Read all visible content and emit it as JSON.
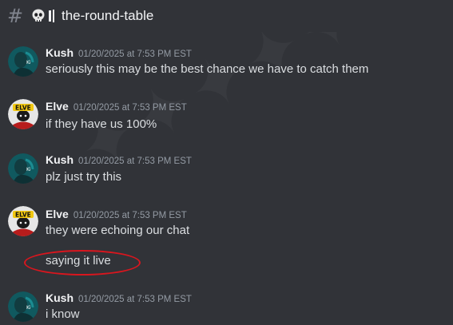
{
  "channel": {
    "name": "the-round-table",
    "icon": "skull-icon"
  },
  "messages": [
    {
      "author": "Kush",
      "timestamp": "01/20/2025 at 7:53 PM EST",
      "text": "seriously this may be the best chance we have to catch them"
    },
    {
      "author": "Elve",
      "timestamp": "01/20/2025 at 7:53 PM EST",
      "text": "if they have us 100%"
    },
    {
      "author": "Kush",
      "timestamp": "01/20/2025 at 7:53 PM EST",
      "text": "plz just try this"
    },
    {
      "author": "Elve",
      "timestamp": "01/20/2025 at 7:53 PM EST",
      "text": "they were echoing our chat",
      "followup": "saying it live"
    },
    {
      "author": "Kush",
      "timestamp": "01/20/2025 at 7:53 PM EST",
      "text": "i know"
    }
  ],
  "avatars": {
    "kush": "teal-portrait-avatar",
    "elve": "elve-logo-avatar"
  },
  "highlight_color": "#d9161e"
}
